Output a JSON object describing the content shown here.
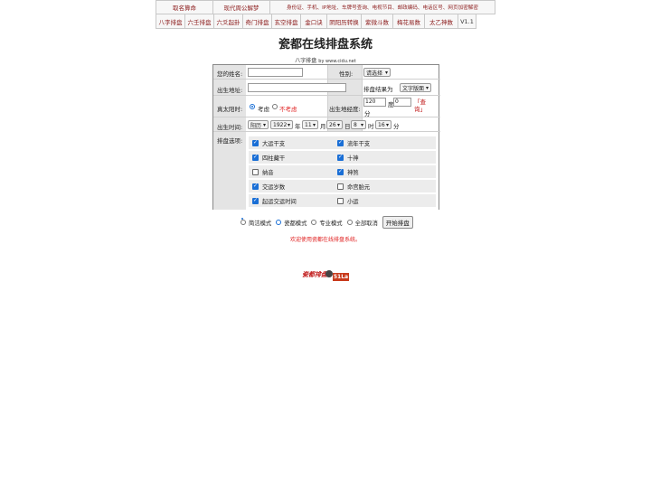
{
  "nav": {
    "row1": [
      {
        "label": "取名算命",
        "w": 64
      },
      {
        "label": "现代周公解梦",
        "w": 64
      },
      {
        "label": "身份证、手机、IP地址、车牌号查询、电视节目、邮政编码、电话区号、网页加密解密",
        "w": 250
      }
    ],
    "row2": [
      "八字排盘",
      "六壬排盘",
      "六爻起卦",
      "奇门排盘",
      "玄空排盘",
      "金口诀",
      "阴阳历转换",
      "紫微斗数",
      "梅花易数",
      "太乙神数",
      "V1.1"
    ]
  },
  "title": "瓷都在线排盘系统",
  "caption": {
    "main": "八字排盘",
    "sub": "by www.cidu.net"
  },
  "form": {
    "name_label": "您的姓名:",
    "gender_label": "性别:",
    "gender_value": "请选择",
    "address_label": "出生地址:",
    "result_label": "排盘结果为",
    "result_value": "文字版面",
    "solar_label": "真太阳时:",
    "solar_opt1": "考虑",
    "solar_opt2": "不考虑",
    "longitude_label": "出生地经度:",
    "longitude_deg": "120",
    "deg_unit": "度",
    "longitude_min": "0",
    "min_unit": "分",
    "query_link": "「查询」",
    "time_label": "出生时间:",
    "calendar_value": "阳历",
    "year_value": "1922",
    "year_unit": "年",
    "month_value": "11",
    "month_unit": "月",
    "day_value": "26",
    "day_unit": "日",
    "hour_value": "8",
    "hour_unit": "时",
    "minute_value": "16",
    "minute_unit": "分",
    "options_label": "排盘选项:"
  },
  "options": [
    {
      "left": "大运干支",
      "left_checked": true,
      "right": "流年干支",
      "right_checked": true
    },
    {
      "left": "四柱藏干",
      "left_checked": true,
      "right": "十神",
      "right_checked": true
    },
    {
      "left": "纳音",
      "left_checked": false,
      "right": "神煞",
      "right_checked": true
    },
    {
      "left": "交运岁数",
      "left_checked": true,
      "right": "命宫胎元",
      "right_checked": false
    },
    {
      "left": "起运交运时间",
      "left_checked": true,
      "right": "小运",
      "right_checked": false
    }
  ],
  "modes": {
    "simple": "简洁模式",
    "cidu": "瓷都模式",
    "pro": "专业模式",
    "cancel_all": "全部取消",
    "submit": "开始排盘"
  },
  "welcome": "欢迎使用瓷都在线排盘系统。",
  "logo": {
    "text": "瓷都排盘",
    "badge": "51La"
  },
  "colors": {
    "nav_text": "#8b1a1a",
    "accent": "#1a6fd6",
    "welcome": "#e02020"
  }
}
